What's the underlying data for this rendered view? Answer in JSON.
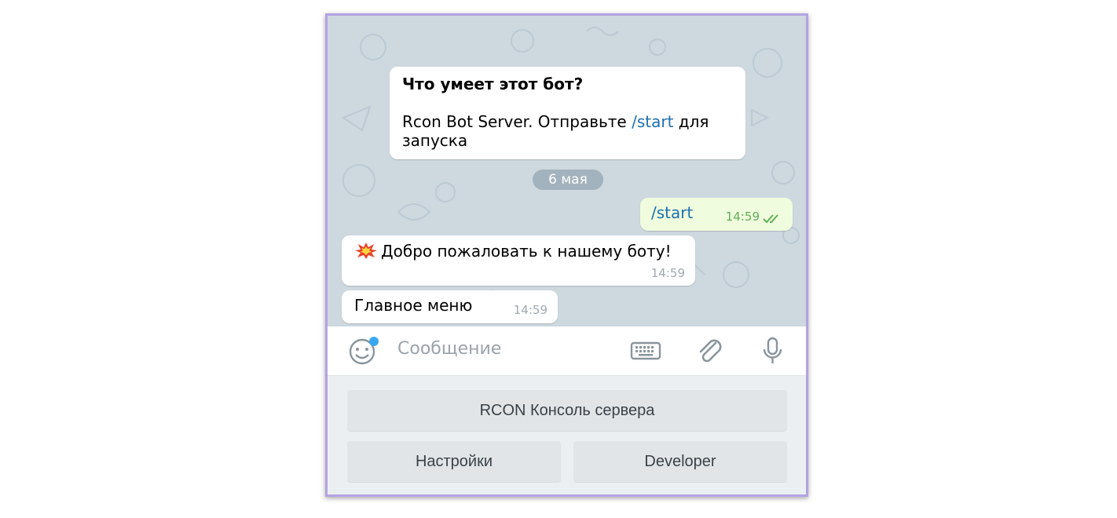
{
  "intro": {
    "title": "Что умеет этот бот?",
    "text_before": "Rcon Bot Server. Отправьте ",
    "command": "/start",
    "text_after": " для запуска"
  },
  "date_separator": "6 мая",
  "messages": [
    {
      "direction": "outgoing",
      "text": "/start",
      "time": "14:59",
      "status_icon": "double-check-icon"
    },
    {
      "direction": "incoming",
      "icon": "explosion-icon",
      "text": "Добро пожаловать к нашему боту!",
      "time": "14:59"
    },
    {
      "direction": "incoming",
      "text": "Главное меню",
      "time": "14:59"
    }
  ],
  "input": {
    "placeholder": "Сообщение",
    "icons": [
      "emoji-icon",
      "keyboard-icon",
      "paperclip-icon",
      "microphone-icon"
    ]
  },
  "bot_keyboard": {
    "rows": [
      [
        "RCON Консоль сервера"
      ],
      [
        "Настройки",
        "Developer"
      ]
    ]
  },
  "colors": {
    "link": "#1e6fb0",
    "outgoing_bubble": "#effdde",
    "outgoing_time": "#62ac55",
    "chat_background": "#cdd8df",
    "frame_border": "#b3a3e0",
    "notification_dot": "#3aa8f0"
  }
}
